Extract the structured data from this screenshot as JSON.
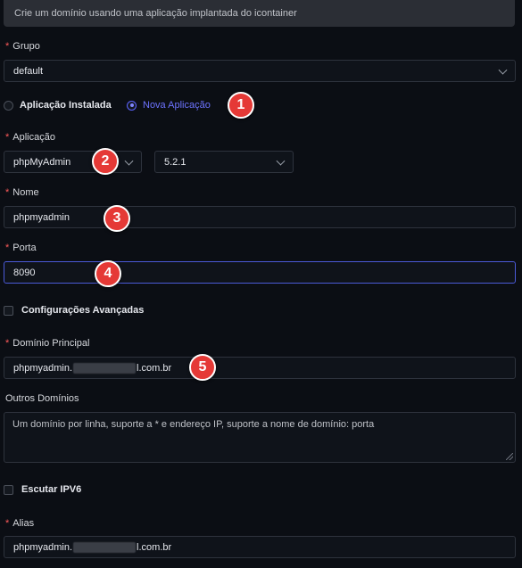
{
  "banner": "Crie um domínio usando uma aplicação implantada do icontainer",
  "grupo": {
    "label": "Grupo",
    "value": "default"
  },
  "source_radio": {
    "installed": "Aplicação Instalada",
    "new": "Nova Aplicação"
  },
  "aplicacao": {
    "label": "Aplicação",
    "app": "phpMyAdmin",
    "version": "5.2.1"
  },
  "nome": {
    "label": "Nome",
    "value": "phpmyadmin"
  },
  "porta": {
    "label": "Porta",
    "value": "8090"
  },
  "advanced": {
    "label": "Configurações Avançadas"
  },
  "dominio_principal": {
    "label": "Domínio Principal",
    "prefix": "phpmyadmin.",
    "suffix": "l.com.br"
  },
  "outros_dominios": {
    "label": "Outros Domínios",
    "placeholder": "Um domínio por linha, suporte a * e endereço IP, suporte a nome de domínio: porta"
  },
  "ipv6": {
    "label": "Escutar IPV6"
  },
  "alias": {
    "label": "Alias",
    "prefix": "phpmyadmin.",
    "suffix": "l.com.br"
  },
  "badges": [
    "1",
    "2",
    "3",
    "4",
    "5"
  ],
  "colors": {
    "accent": "#5b63ff",
    "required": "#ff5b5b",
    "badge": "#e53936",
    "background": "#0b0e14"
  }
}
